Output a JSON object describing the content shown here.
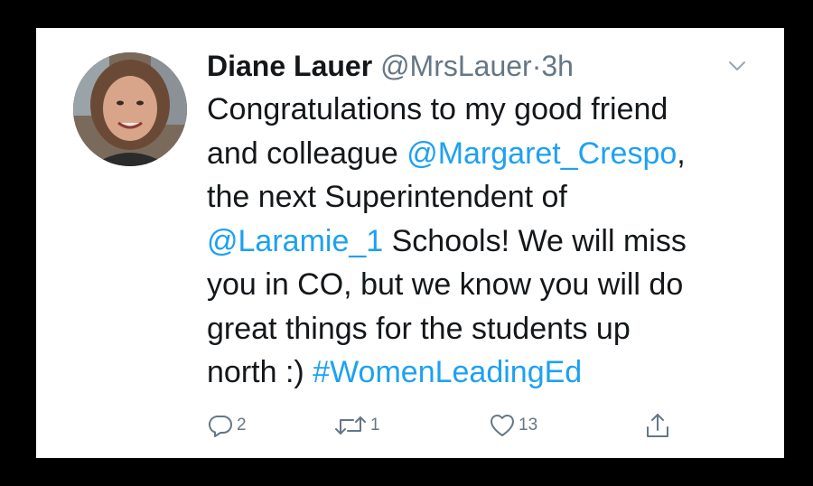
{
  "tweet": {
    "author_name": "Diane Lauer",
    "author_handle": "@MrsLauer",
    "separator": "·",
    "time": "3h",
    "body": {
      "l1": "Congratulations to my good friend",
      "l2a": "and colleague ",
      "l2b": "@Margaret_Crespo",
      "l2c": ",",
      "l3": "the next Superintendent of",
      "l4a": "@Laramie_1",
      "l4b": " Schools! We will miss",
      "l5": "you in CO, but we know you will do",
      "l6": "great things for the students up",
      "l7a": "north :) ",
      "l7b": "#WomenLeadingEd"
    },
    "actions": {
      "reply_count": "2",
      "retweet_count": "1",
      "like_count": "13"
    }
  },
  "icons": {
    "reply": "reply-icon",
    "retweet": "retweet-icon",
    "like": "heart-icon",
    "share": "share-icon",
    "menu": "chevron-down-icon"
  },
  "colors": {
    "link": "#1da1f2",
    "text": "#14171a",
    "muted": "#657786",
    "background": "#ffffff",
    "frame": "#000000"
  }
}
